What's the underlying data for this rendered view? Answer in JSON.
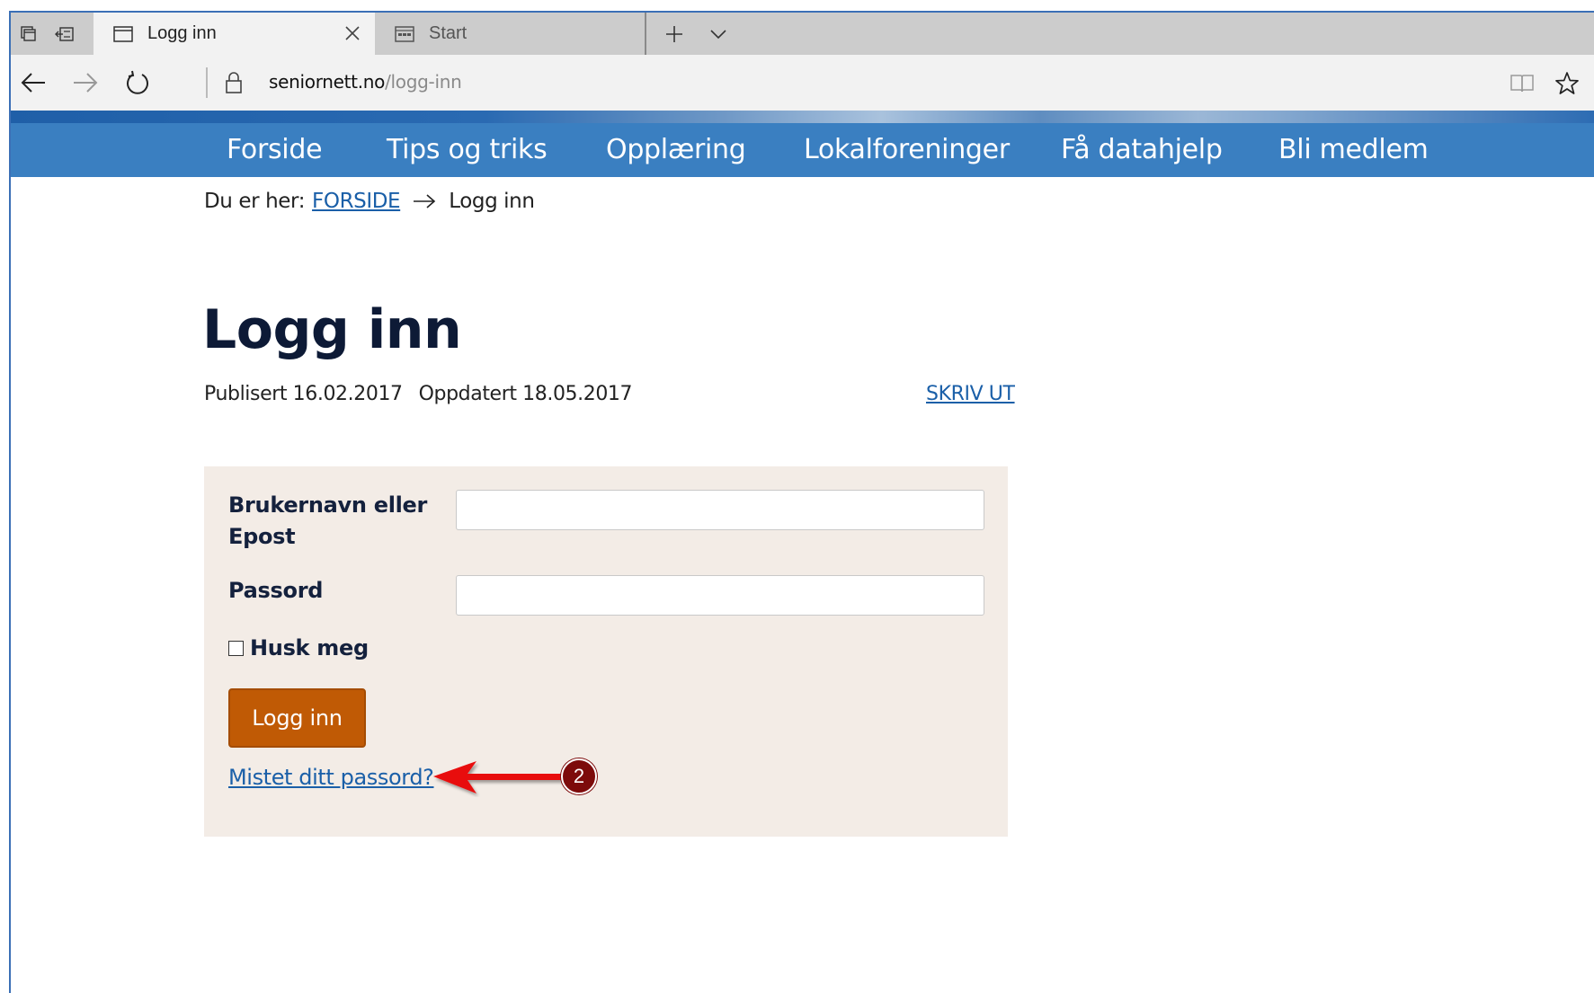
{
  "browser": {
    "tabs": [
      {
        "title": "Logg inn",
        "active": true
      },
      {
        "title": "Start",
        "active": false
      }
    ],
    "address": {
      "host": "seniornett.no",
      "path": "/logg-inn"
    }
  },
  "site": {
    "nav": [
      "Forside",
      "Tips og triks",
      "Opplæring",
      "Lokalforeninger",
      "Få datahjelp",
      "Bli medlem"
    ],
    "accent_color": "#3a7fc1",
    "button_color": "#c05a05",
    "box_color": "#f3ece6"
  },
  "breadcrumb": {
    "prefix": "Du er her:",
    "home": "FORSIDE",
    "current": "Logg inn"
  },
  "page": {
    "title": "Logg inn",
    "published": "Publisert 16.02.2017",
    "updated": "Oppdatert 18.05.2017",
    "print": "SKRIV UT"
  },
  "login_form": {
    "username_label_line1": "Brukernavn eller",
    "username_label_line2": "Epost",
    "username_value": "",
    "password_label": "Passord",
    "password_value": "",
    "remember_label": "Husk meg",
    "remember_checked": false,
    "submit_label": "Logg inn",
    "lost_password": "Mistet ditt passord?"
  },
  "annotation": {
    "badge_number": "2",
    "color": "#e81010"
  }
}
